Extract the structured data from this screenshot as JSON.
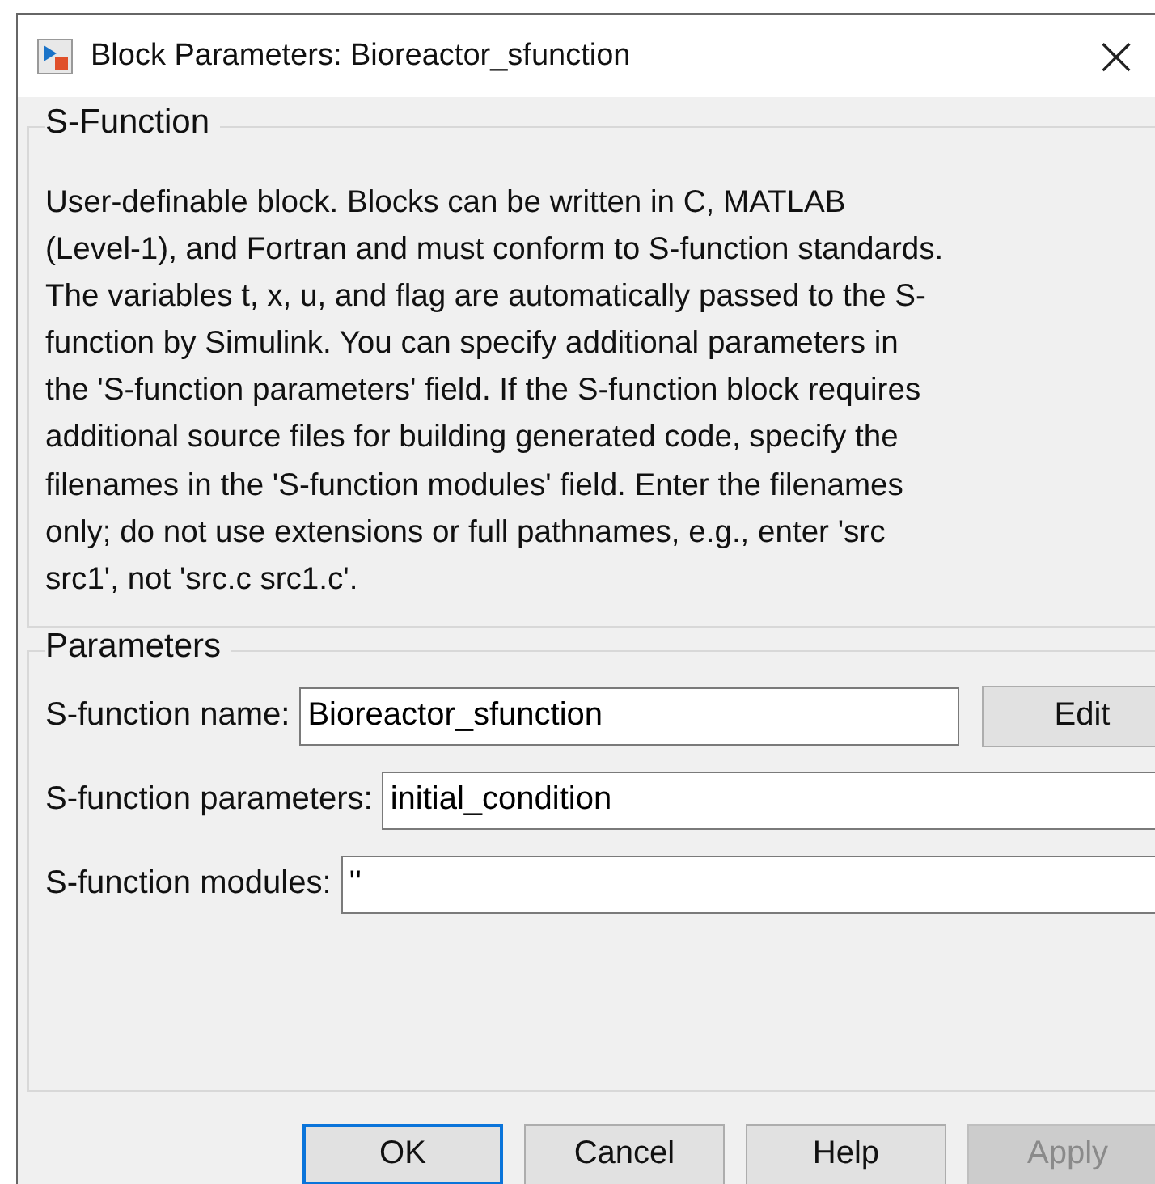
{
  "window": {
    "title": "Block Parameters: Bioreactor_sfunction",
    "close": "×"
  },
  "description_group": {
    "legend": "S-Function",
    "text": "User-definable block.  Blocks can be written in C, MATLAB\n(Level-1), and Fortran and must conform to S-function standards.\nThe variables t, x, u, and flag are automatically passed to the S-\nfunction by Simulink.  You can specify additional parameters in\nthe 'S-function parameters' field. If the S-function block requires\nadditional source files for building generated code, specify the\nfilenames in the 'S-function modules' field. Enter the filenames\nonly; do not use extensions or full pathnames, e.g., enter 'src\nsrc1', not 'src.c src1.c'."
  },
  "parameters_group": {
    "legend": "Parameters",
    "fields": [
      {
        "label": "S-function name:",
        "value": "Bioreactor_sfunction",
        "button": "Edit"
      },
      {
        "label": "S-function parameters:",
        "value": "initial_condition"
      },
      {
        "label": "S-function modules:",
        "value": "''"
      }
    ]
  },
  "buttons": [
    {
      "label": "OK",
      "focused": true,
      "disabled": false
    },
    {
      "label": "Cancel",
      "focused": false,
      "disabled": false
    },
    {
      "label": "Help",
      "focused": false,
      "disabled": false
    },
    {
      "label": "Apply",
      "focused": false,
      "disabled": true
    }
  ]
}
